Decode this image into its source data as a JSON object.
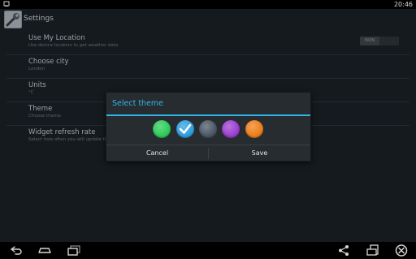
{
  "status_bar": {
    "time": "20:46"
  },
  "app": {
    "title": "Settings"
  },
  "preferences": [
    {
      "title": "Use My Location",
      "summary": "Use device locators to get weather data",
      "switch_label": "NON"
    },
    {
      "title": "Choose city",
      "summary": "London"
    },
    {
      "title": "Units",
      "summary": "°C"
    },
    {
      "title": "Theme",
      "summary": "Choose theme"
    },
    {
      "title": "Widget refresh rate",
      "summary": "Select how often you will update the"
    }
  ],
  "dialog": {
    "title": "Select theme",
    "swatches": [
      {
        "name": "green",
        "color": "#2ecc5a",
        "selected": false
      },
      {
        "name": "blue",
        "color": "#2f9fe0",
        "selected": true
      },
      {
        "name": "slate",
        "color": "#4a5866",
        "selected": false
      },
      {
        "name": "purple",
        "color": "#9b3fd1",
        "selected": false
      },
      {
        "name": "orange",
        "color": "#ef7f1a",
        "selected": false
      }
    ],
    "cancel_label": "Cancel",
    "save_label": "Save"
  },
  "colors": {
    "accent": "#33b5e5",
    "background": "#1a2026",
    "dialog": "#272c31"
  }
}
